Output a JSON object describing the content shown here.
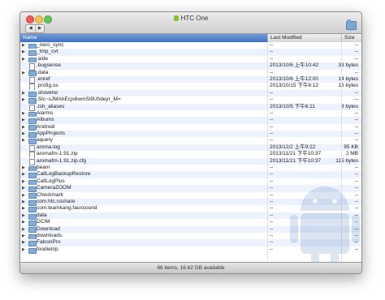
{
  "window": {
    "title": "HTC One",
    "nav_back": "◀",
    "nav_forward": "▶"
  },
  "columns": {
    "name": "Name",
    "modified": "Last Modified",
    "size": "Size"
  },
  "rows": [
    {
      "name": "_nero_sync",
      "modified": "--",
      "size": "--",
      "type": "folder"
    },
    {
      "name": "_tmp_cvt",
      "modified": "--",
      "size": "--",
      "type": "folder"
    },
    {
      "name": ".aide",
      "modified": "--",
      "size": "--",
      "type": "folder"
    },
    {
      "name": ".bugsense",
      "modified": "2013/10/6 上午10:42",
      "size": "33 bytes",
      "type": "file"
    },
    {
      "name": ".data",
      "modified": "--",
      "size": "--",
      "type": "folder"
    },
    {
      "name": ".enref",
      "modified": "2013/10/6 上午12:00",
      "size": "14 bytes",
      "type": "file"
    },
    {
      "name": ".profig.os",
      "modified": "2013/10/15 下午6:12",
      "size": "16 bytes",
      "type": "file"
    },
    {
      "name": ".showme",
      "modified": "--",
      "size": "--",
      "type": "folder"
    },
    {
      "name": ".Slc~sJMAhEcjs6wmSi9Uhdeyr_M=",
      "modified": "--",
      "size": "--",
      "type": "folder"
    },
    {
      "name": ".tsh_aliases",
      "modified": "2013/10/5 下午6:11",
      "size": "8 bytes",
      "type": "file"
    },
    {
      "name": "Alarms",
      "modified": "--",
      "size": "--",
      "type": "folder"
    },
    {
      "name": "Albums",
      "modified": "--",
      "size": "--",
      "type": "folder"
    },
    {
      "name": "Android",
      "modified": "--",
      "size": "--",
      "type": "folder"
    },
    {
      "name": "AppProjects",
      "modified": "--",
      "size": "--",
      "type": "folder"
    },
    {
      "name": "aquery",
      "modified": "--",
      "size": "--",
      "type": "folder"
    },
    {
      "name": "aroma.log",
      "modified": "2013/12/2 上午9:22",
      "size": "95 KB",
      "type": "file"
    },
    {
      "name": "aromafm-1.91.zip",
      "modified": "2013/11/21 下午10:37",
      "size": "2 MB",
      "type": "file"
    },
    {
      "name": "aromafm-1.91.zip.cfg",
      "modified": "2013/11/21 下午10:37",
      "size": "115 bytes",
      "type": "file"
    },
    {
      "name": "beam",
      "modified": "--",
      "size": "--",
      "type": "folder"
    },
    {
      "name": "CallLogBackupRestore",
      "modified": "--",
      "size": "--",
      "type": "folder"
    },
    {
      "name": "CallLogPlus",
      "modified": "--",
      "size": "--",
      "type": "folder"
    },
    {
      "name": "CameraZOOM",
      "modified": "--",
      "size": "--",
      "type": "folder"
    },
    {
      "name": "Checkmark",
      "modified": "--",
      "size": "--",
      "type": "folder"
    },
    {
      "name": "com.htc.csshare",
      "modified": "--",
      "size": "--",
      "type": "folder"
    },
    {
      "name": "com.teamkang.fauxsound",
      "modified": "--",
      "size": "--",
      "type": "folder"
    },
    {
      "name": "data",
      "modified": "--",
      "size": "--",
      "type": "folder"
    },
    {
      "name": "DCIM",
      "modified": "--",
      "size": "--",
      "type": "folder"
    },
    {
      "name": "Download",
      "modified": "--",
      "size": "--",
      "type": "folder"
    },
    {
      "name": "downloads",
      "modified": "--",
      "size": "--",
      "type": "folder"
    },
    {
      "name": "FalconPro",
      "modified": "--",
      "size": "--",
      "type": "folder"
    },
    {
      "name": "foodietrip",
      "modified": "--",
      "size": "--",
      "type": "folder"
    }
  ],
  "status": {
    "text": "66 items, 16.62 GB available"
  },
  "icons": {
    "folder": "folder-icon",
    "file": "file-icon",
    "disclosure": "disclosure-triangle-icon",
    "new_folder": "new-folder-icon",
    "title_device": "android-device-icon"
  },
  "colors": {
    "header_bg": "#3f73c1",
    "row_alt": "#edf3fe",
    "folder": "#84acd8"
  }
}
